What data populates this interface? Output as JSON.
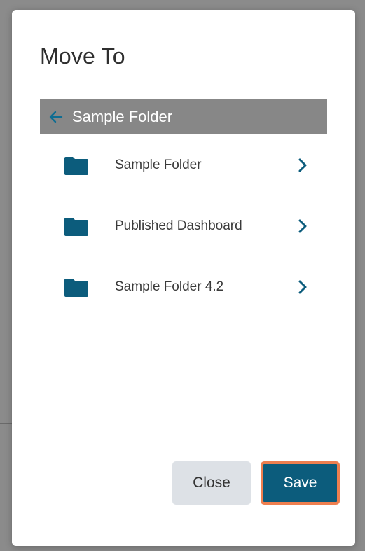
{
  "dialog": {
    "title": "Move To"
  },
  "breadcrumb": {
    "current_folder": "Sample Folder",
    "back_icon": "arrow-left-icon"
  },
  "folders": [
    {
      "name": "Sample Folder",
      "icon": "folder-icon"
    },
    {
      "name": "Published Dashboard",
      "icon": "folder-icon"
    },
    {
      "name": "Sample Folder 4.2",
      "icon": "folder-icon"
    }
  ],
  "buttons": {
    "close_label": "Close",
    "save_label": "Save"
  },
  "colors": {
    "accent": "#0c5c7c",
    "folder": "#0c5c7c",
    "breadcrumb_bg": "#878787",
    "save_outline": "#ef7f4f",
    "close_bg": "#dde1e6"
  }
}
